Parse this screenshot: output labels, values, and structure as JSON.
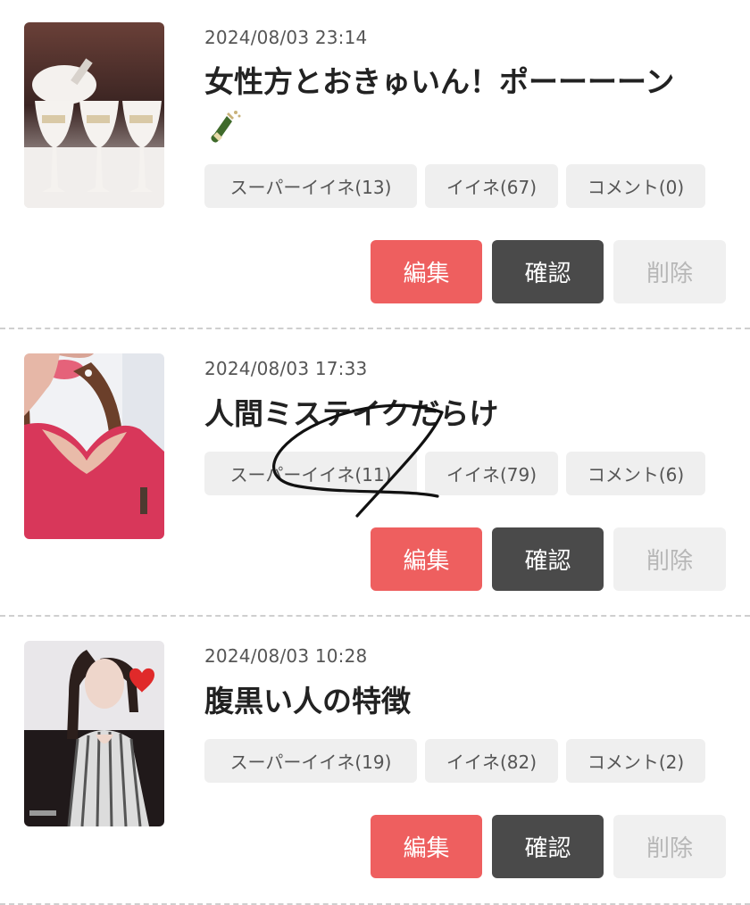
{
  "posts": [
    {
      "date": "2024/08/03 23:14",
      "title": "女性方とおきゅいん！ポーーーーン",
      "title_emoji": "bottle-with-popping-cork",
      "reactions": [
        "スーパーイイネ(13)",
        "イイネ(67)",
        "コメント(0)"
      ],
      "actions": {
        "edit": "編集",
        "confirm": "確認",
        "delete": "削除"
      }
    },
    {
      "date": "2024/08/03 17:33",
      "title": "人間ミステイクだらけ",
      "reactions": [
        "スーパーイイネ(11)",
        "イイネ(79)",
        "コメント(6)"
      ],
      "actions": {
        "edit": "編集",
        "confirm": "確認",
        "delete": "削除"
      }
    },
    {
      "date": "2024/08/03 10:28",
      "title": "腹黒い人の特徴",
      "reactions": [
        "スーパーイイネ(19)",
        "イイネ(82)",
        "コメント(2)"
      ],
      "actions": {
        "edit": "編集",
        "confirm": "確認",
        "delete": "削除"
      }
    }
  ],
  "colors": {
    "edit_button": "#ee5f5f",
    "confirm_button": "#4a4a4a",
    "delete_button": "#f0f0f0",
    "chip_background": "#efefef"
  }
}
